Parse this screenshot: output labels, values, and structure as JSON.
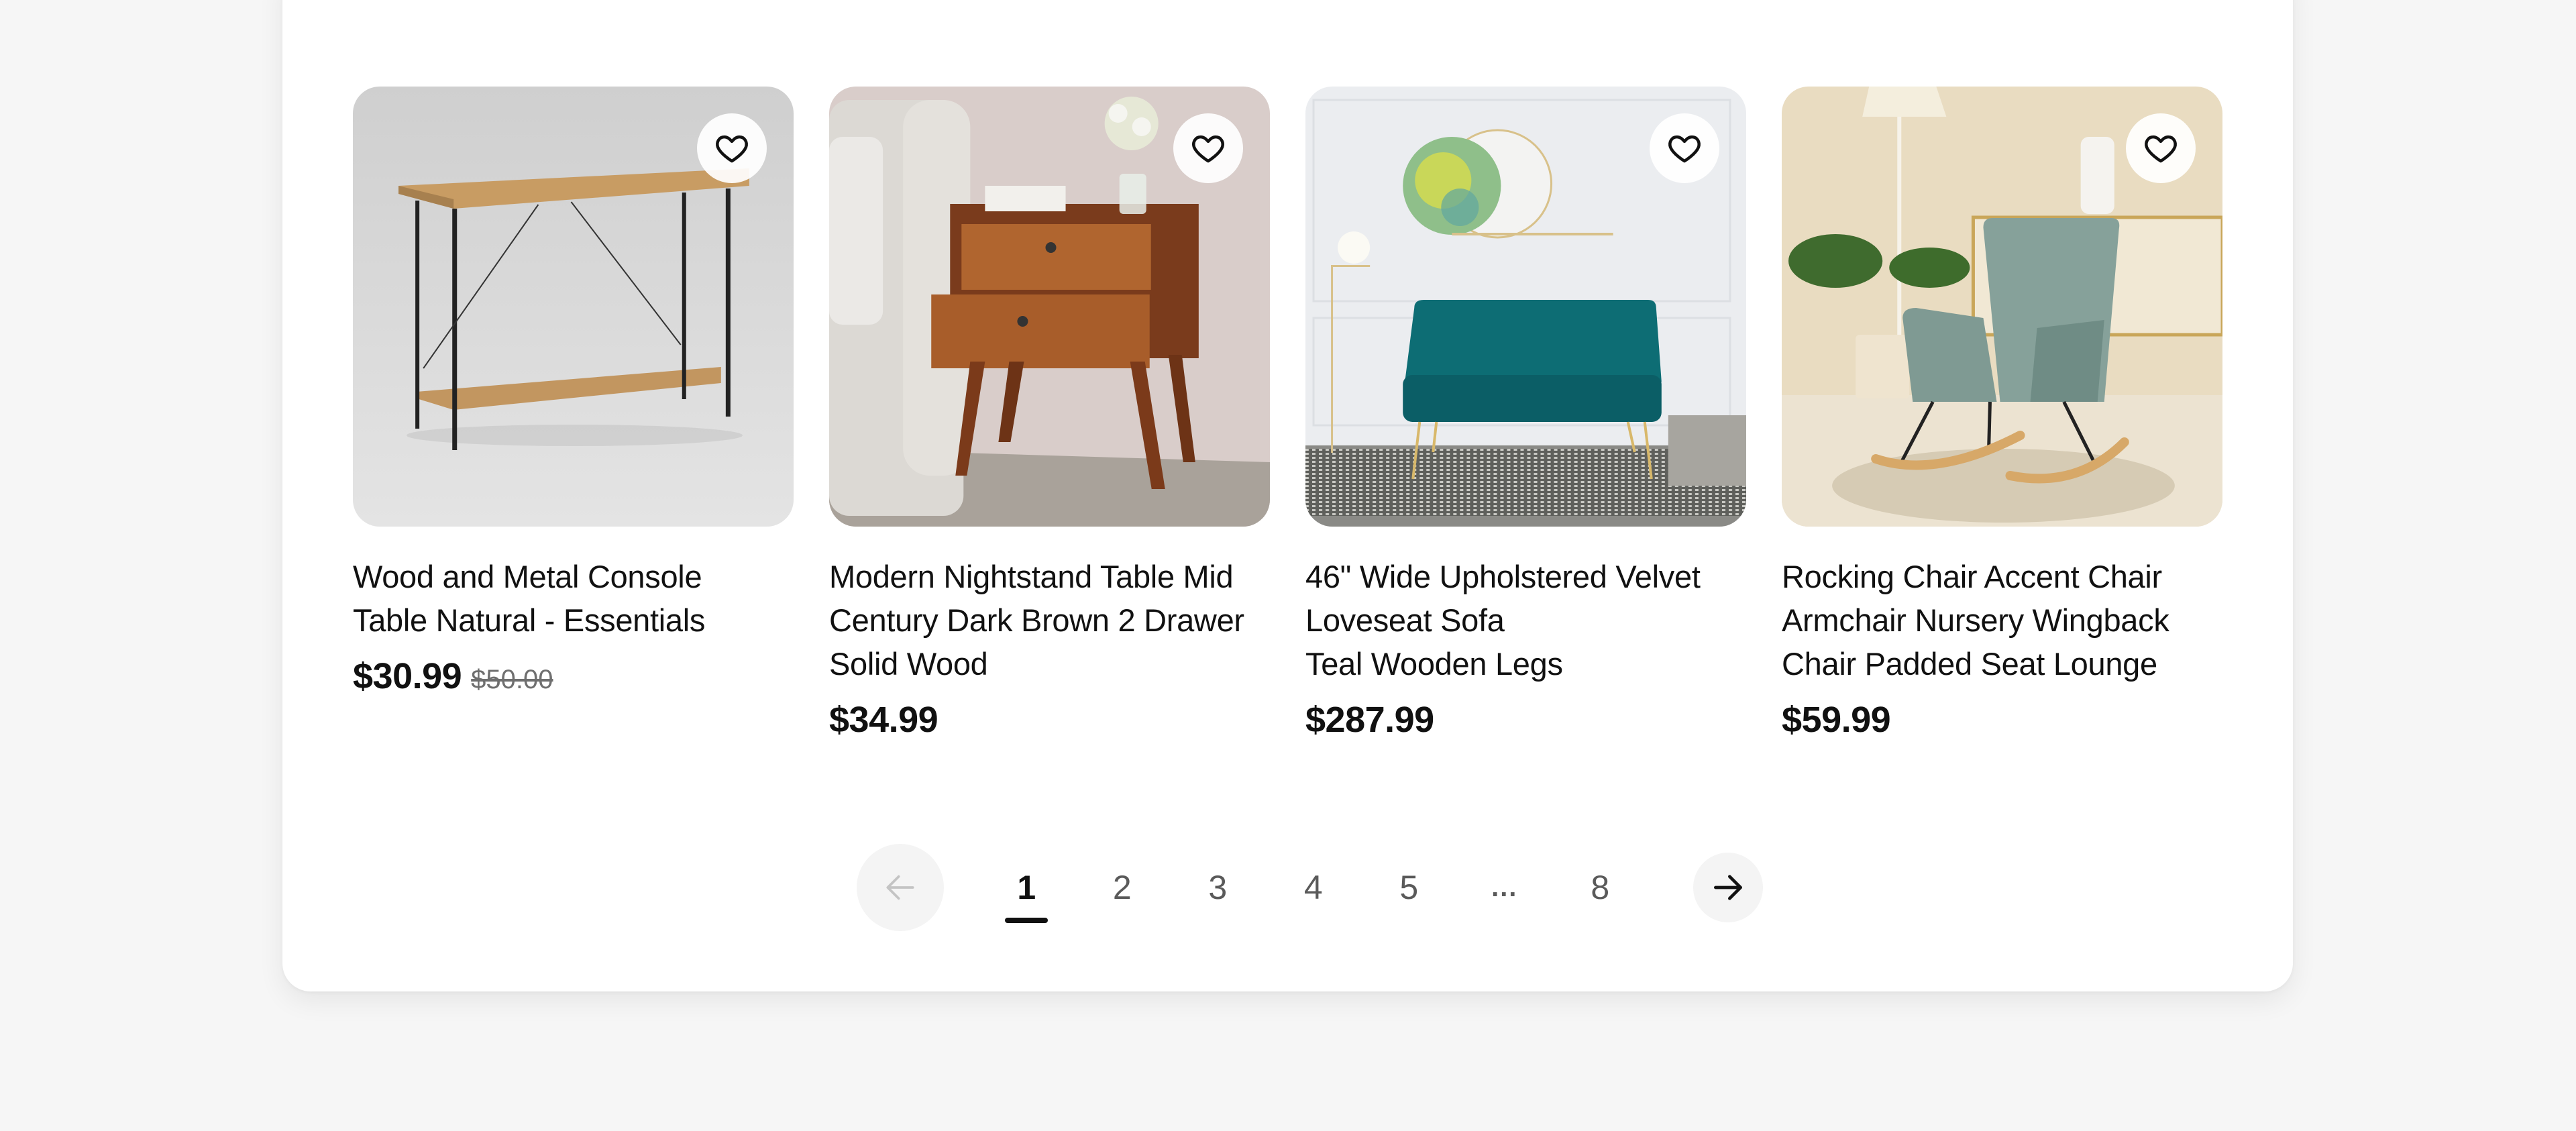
{
  "products": [
    {
      "title": "Wood and Metal Console\nTable Natural - Essentials",
      "price": "$30.99",
      "old_price": "$50.00",
      "favorite": false,
      "image_alt": "Wood and metal console table"
    },
    {
      "title": "Modern Nightstand Table Mid\nCentury Dark Brown 2 Drawer\nSolid Wood",
      "price": "$34.99",
      "old_price": null,
      "favorite": false,
      "image_alt": "Mid century nightstand with two drawers"
    },
    {
      "title": "46\" Wide Upholstered Velvet\nLoveseat Sofa\nTeal Wooden Legs",
      "price": "$287.99",
      "old_price": null,
      "favorite": false,
      "image_alt": "Teal velvet loveseat sofa"
    },
    {
      "title": "Rocking Chair Accent Chair\nArmchair Nursery Wingback\nChair Padded Seat Lounge",
      "price": "$59.99",
      "old_price": null,
      "favorite": false,
      "image_alt": "Sage green rocking chair"
    }
  ],
  "pagination": {
    "current_page": 1,
    "pages": [
      "1",
      "2",
      "3",
      "4",
      "5",
      "...",
      "8"
    ],
    "prev_icon": "arrow-left-icon",
    "next_icon": "arrow-right-icon",
    "prev_disabled": true
  },
  "icons": {
    "favorite": "heart-outline-icon"
  },
  "colors": {
    "page_background": "#f6f6f6",
    "panel_background": "#ffffff",
    "text_primary": "#111111",
    "text_muted": "#6f6f6f",
    "nav_button_bg": "#f4f4f4",
    "prev_arrow_disabled": "#c4c4c4"
  }
}
